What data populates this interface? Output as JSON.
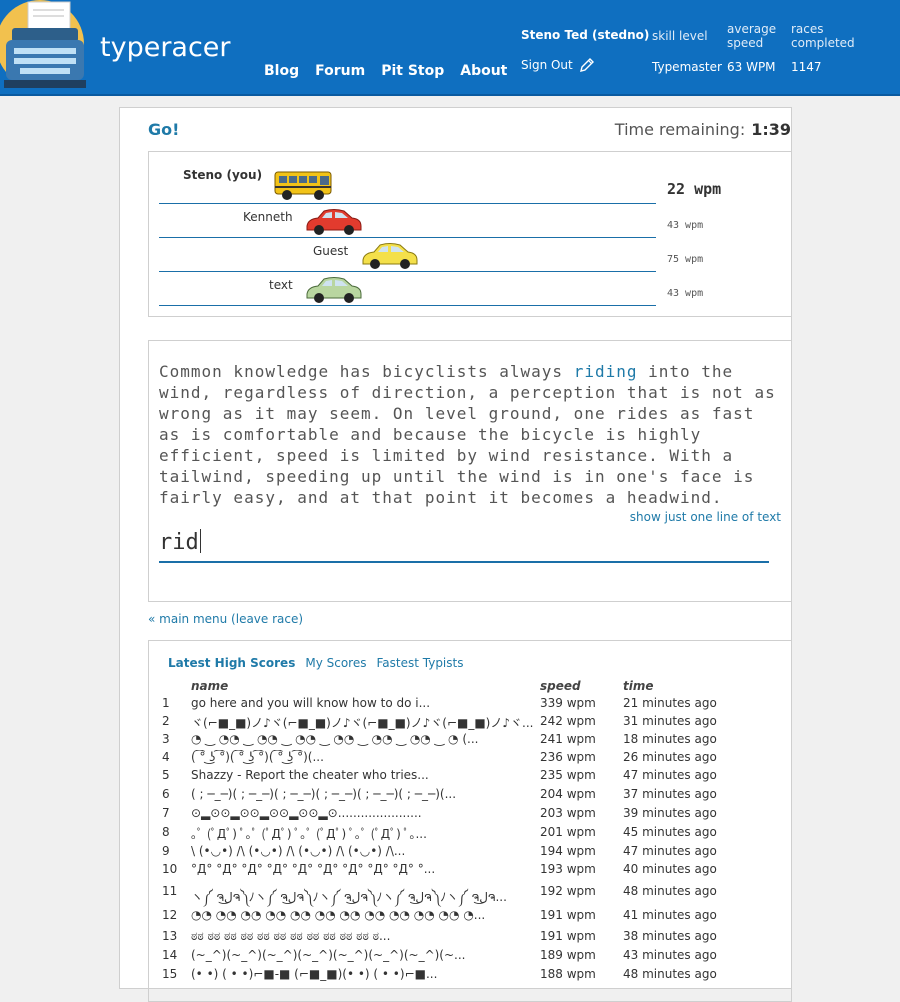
{
  "header": {
    "brand": "typeracer",
    "nav": [
      "Blog",
      "Forum",
      "Pit Stop",
      "About"
    ],
    "user": "Steno Ted (stedno)",
    "sign_out": "Sign Out",
    "skill_label": "skill level",
    "skill_value": "Typemaster",
    "avg_label_1": "average",
    "avg_label_2": "speed",
    "avg_value": "63 WPM",
    "races_label_1": "races",
    "races_label_2": "completed",
    "races_value": "1147"
  },
  "race": {
    "status": "Go!",
    "time_label": "Time remaining:",
    "time_value": "1:39",
    "racers": [
      {
        "name": "Steno (you)",
        "wpm": "22 wpm",
        "progress": 0.17,
        "car": "school-bus"
      },
      {
        "name": "Kenneth",
        "wpm": "43 wpm",
        "progress": 0.3,
        "car": "red-car"
      },
      {
        "name": "Guest",
        "wpm": "75 wpm",
        "progress": 0.44,
        "car": "yellow-car"
      },
      {
        "name": "text",
        "wpm": "43 wpm",
        "progress": 0.3,
        "car": "green-car"
      }
    ],
    "text_before": "Common knowledge has bicyclists always ",
    "text_current": "riding",
    "text_after": " into the wind, regardless of direction, a perception that is not as wrong as it may seem. On level ground, one rides as fast as is comfortable and because the bicycle is highly efficient, speed is limited by wind resistance. With a tailwind, speeding up until the wind is in one's face is fairly easy, and at that point it becomes a headwind.",
    "one_line_link": "show just one line of text",
    "input_value": "rid",
    "main_menu_link": "« main menu (leave race)"
  },
  "scores": {
    "tabs": [
      "Latest High Scores",
      "My Scores",
      "Fastest Typists"
    ],
    "headers": {
      "name": "name",
      "speed": "speed",
      "time": "time"
    },
    "rows": [
      {
        "rank": "1",
        "name": "go here and you will know how to do i...",
        "speed": "339 wpm",
        "time": "21 minutes ago"
      },
      {
        "rank": "2",
        "name": "ヾ(⌐■_■)ノ♪ヾ(⌐■_■)ノ♪ヾ(⌐■_■)ノ♪ヾ(⌐■_■)ノ♪ヾ...",
        "speed": "242 wpm",
        "time": "31 minutes ago"
      },
      {
        "rank": "3",
        "name": "◔ ‿ ◔◔ ‿ ◔◔ ‿ ◔◔ ‿ ◔◔ ‿ ◔◔ ‿ ◔◔ ‿ ◔ (...",
        "speed": "241 wpm",
        "time": "18 minutes ago"
      },
      {
        "rank": "4",
        "name": "( ͡° ͜ʖ ͡°)( ͡° ͜ʖ ͡°)( ͡° ͜ʖ ͡°)(...",
        "speed": "236 wpm",
        "time": "26 minutes ago"
      },
      {
        "rank": "5",
        "name": "Shazzy - Report the cheater who tries...",
        "speed": "235 wpm",
        "time": "47 minutes ago"
      },
      {
        "rank": "6",
        "name": "( ; ─_─)( ; ─_─)( ; ─_─)( ; ─_─)( ; ─_─)( ; ─_─)(...",
        "speed": "204 wpm",
        "time": "37 minutes ago"
      },
      {
        "rank": "7",
        "name": "⊙▂⊙⊙▂⊙⊙▂⊙⊙▂⊙⊙▂⊙......................",
        "speed": "203 wpm",
        "time": "39 minutes ago"
      },
      {
        "rank": "8",
        "name": "｡ﾟ (ﾟДﾟ) ﾟ｡ﾟ (ﾟДﾟ) ﾟ｡ﾟ (ﾟДﾟ) ﾟ｡ﾟ (ﾟДﾟ) ﾟ｡...",
        "speed": "201 wpm",
        "time": "45 minutes ago"
      },
      {
        "rank": "9",
        "name": "\\ (•◡•) /\\ (•◡•) /\\ (•◡•) /\\ (•◡•) /\\...",
        "speed": "194 wpm",
        "time": "47 minutes ago"
      },
      {
        "rank": "10",
        "name": "°Д° °Д° °Д° °Д° °Д° °Д° °Д° °Д° °Д° °...",
        "speed": "193 wpm",
        "time": "40 minutes ago"
      },
      {
        "rank": "11",
        "name": "ヽ༼ ຈل͜ຈ༽ﾉヽ༼ ຈل͜ຈ༽ﾉヽ༼ ຈل͜ຈ༽ﾉヽ༼ ຈل͜ຈ༽ﾉヽ༼ ຈل͜ຈ...",
        "speed": "192 wpm",
        "time": "48 minutes ago"
      },
      {
        "rank": "12",
        "name": "◔◔ ◔◔ ◔◔ ◔◔ ◔◔ ◔◔ ◔◔ ◔◔ ◔◔ ◔◔ ◔◔ ◔...",
        "speed": "191 wpm",
        "time": "41 minutes ago"
      },
      {
        "rank": "13",
        "name": "ಠಠ ಠಠ ಠಠ ಠಠ ಠಠ ಠಠ ಠಠ ಠಠ ಠಠ ಠಠ ಠಠ ಠ...",
        "speed": "191 wpm",
        "time": "38 minutes ago"
      },
      {
        "rank": "14",
        "name": "(~_^)(~_^)(~_^)(~_^)(~_^)(~_^)(~_^)(~...",
        "speed": "189 wpm",
        "time": "43 minutes ago"
      },
      {
        "rank": "15",
        "name": "(• •) ( • •)⌐■-■ (⌐■_■)(• •) ( • •)⌐■...",
        "speed": "188 wpm",
        "time": "48 minutes ago"
      }
    ]
  },
  "colors": {
    "header": "#0f6fc0",
    "link": "#1f7aa8"
  }
}
